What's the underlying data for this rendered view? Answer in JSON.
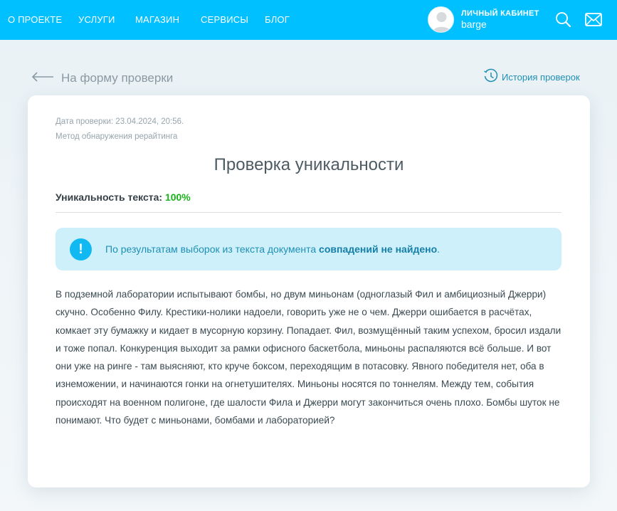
{
  "nav": {
    "items": [
      "О ПРОЕКТЕ",
      "УСЛУГИ",
      "МАГАЗИН",
      "СЕРВИСЫ",
      "БЛОГ"
    ]
  },
  "account": {
    "title": "ЛИЧНЫЙ КАБИНЕТ",
    "username": "barge"
  },
  "icons": {
    "search": "search-icon",
    "mail": "mail-icon",
    "back": "arrow-left-icon",
    "history": "history-clock-icon",
    "alert": "exclamation-icon"
  },
  "back_link": "На форму проверки",
  "history_link": "История проверок",
  "result": {
    "date": "Дата проверки: 23.04.2024, 20:56.",
    "method": "Метод обнаружения рерайтинга",
    "title": "Проверка уникальности",
    "uniq_label": "Уникальность текста: ",
    "uniq_value": "100%",
    "alert_prefix": "По результатам выборок из текста документа ",
    "alert_bold": "совпадений не найдено",
    "alert_suffix": ".",
    "text": "В подземной лаборатории испытывают бомбы, но двум миньонам (одноглазый Фил и амбициозный Джерри) скучно. Особенно Филу. Крестики-нолики надоели, говорить уже не о чем. Джерри ошибается в расчётах, комкает эту бумажку и кидает в мусорную корзину. Попадает. Фил, возмущённый таким успехом, бросил издали и тоже попал. Конкуренция выходит за рамки офисного баскетбола, миньоны распаляются всё больше. И вот они уже на ринге - там выясняют, кто круче боксом, переходящим в потасовку. Явного победителя нет, оба в изнеможении, и начинаются гонки на огнетушителях. Миньоны носятся по тоннелям. Между тем, события происходят на военном полигоне, где шалости Фила и Джерри могут закончиться очень плохо. Бомбы шуток не понимают. Что будет с миньонами, бомбами и лабораторией?"
  },
  "colors": {
    "topbar": "#00c0ff",
    "accent_link": "#1f8fb5",
    "uniq_green": "#1bb31b",
    "alert_bg": "#cdf0fb",
    "alert_icon": "#10b9f2"
  }
}
